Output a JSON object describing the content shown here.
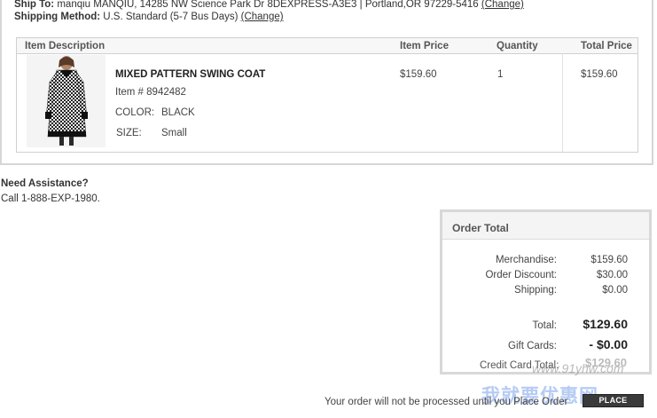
{
  "shipping": {
    "ship_to_label": "Ship To:",
    "ship_to_value": "manqiu MANQIU, 14285 NW Science Park Dr 8DEXPRESS-A3E3 | Portland,OR 97229-5416",
    "ship_to_change": "(Change)",
    "method_label": "Shipping Method:",
    "method_value": "U.S. Standard (5-7 Bus Days)",
    "method_change": "(Change)"
  },
  "items_table": {
    "headers": {
      "description": "Item Description",
      "price": "Item Price",
      "quantity": "Quantity",
      "total": "Total Price"
    },
    "item": {
      "name": "MIXED PATTERN SWING COAT",
      "number": "Item # 8942482",
      "color_label": "COLOR:",
      "color_value": "BLACK",
      "size_label": "SIZE:",
      "size_value": "Small",
      "price": "$159.60",
      "quantity": "1",
      "total": "$159.60"
    }
  },
  "assistance": {
    "title": "Need Assistance?",
    "phone": "Call 1-888-EXP-1980."
  },
  "order_total": {
    "title": "Order Total",
    "merchandise_label": "Merchandise:",
    "merchandise_value": "$159.60",
    "discount_label": "Order Discount:",
    "discount_value": "$30.00",
    "shipping_label": "Shipping:",
    "shipping_value": "$0.00",
    "total_label": "Total:",
    "total_value": "$129.60",
    "gift_cards_label": "Gift Cards:",
    "gift_cards_value": "- $0.00",
    "credit_card_label": "Credit Card Total:",
    "credit_card_value": "$129.60"
  },
  "footer": {
    "note": "Your order will not be processed until you Place Order",
    "place_order_label": "PLACE ORDER"
  },
  "watermark": {
    "url": "www.91yhw.com",
    "text": "我就要优惠网"
  }
}
